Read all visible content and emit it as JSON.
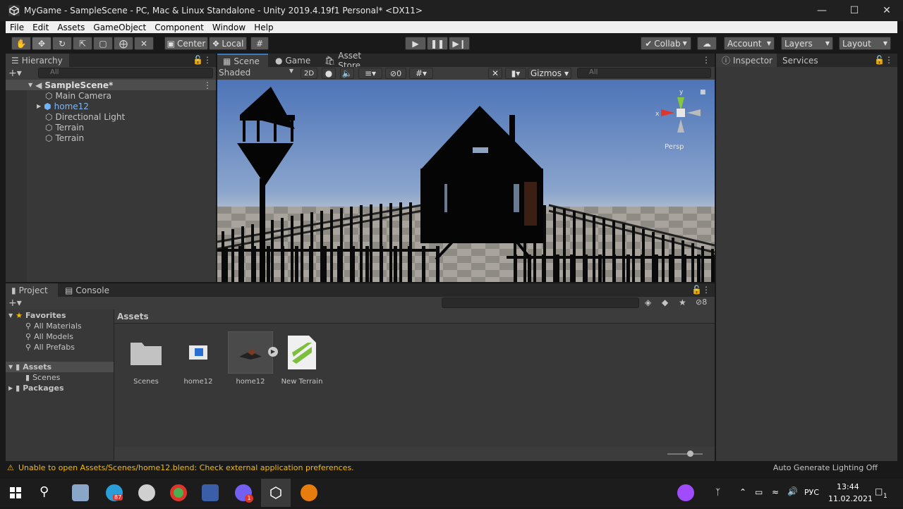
{
  "window": {
    "title": "MyGame - SampleScene - PC, Mac & Linux Standalone - Unity 2019.4.19f1 Personal* <DX11>"
  },
  "menu": [
    "File",
    "Edit",
    "Assets",
    "GameObject",
    "Component",
    "Window",
    "Help"
  ],
  "toolbar": {
    "center_label": "Center",
    "local_label": "Local",
    "collab_label": "Collab",
    "account_label": "Account",
    "layers_label": "Layers",
    "layout_label": "Layout"
  },
  "hierarchy": {
    "tab": "Hierarchy",
    "search_placeholder": "All",
    "scene": "SampleScene*",
    "items": [
      "Main Camera",
      "home12",
      "Directional Light",
      "Terrain",
      "Terrain"
    ]
  },
  "scene_tabs": {
    "scene": "Scene",
    "game": "Game",
    "asset_store": "Asset Store"
  },
  "scene_toolbar": {
    "shading": "Shaded",
    "mode2d": "2D",
    "hidden_count": "0",
    "gizmos": "Gizmos",
    "search_placeholder": "All"
  },
  "gizmo": {
    "x": "x",
    "y": "y",
    "persp": "Persp"
  },
  "inspector": {
    "tab": "Inspector",
    "services": "Services"
  },
  "project": {
    "tab": "Project",
    "console": "Console",
    "favorites": {
      "label": "Favorites",
      "items": [
        "All Materials",
        "All Models",
        "All Prefabs"
      ]
    },
    "tree": {
      "assets": "Assets",
      "scenes": "Scenes",
      "packages": "Packages"
    },
    "breadcrumb": "Assets",
    "hidden_count": "8",
    "assets": [
      "Scenes",
      "home12",
      "home12",
      "New Terrain"
    ]
  },
  "status": {
    "message": "Unable to open Assets/Scenes/home12.blend: Check external application preferences.",
    "lighting": "Auto Generate Lighting Off"
  },
  "taskbar": {
    "telegram_badge": "87",
    "viber_badge": "1",
    "lang": "РУС",
    "time": "13:44",
    "date": "11.02.2021",
    "notif": "1"
  },
  "colors": {
    "accent": "#3a79bb",
    "selected": "#2c5d87",
    "warning": "#f4bc02",
    "gizmo_x": "#e0352b",
    "gizmo_y": "#86c83d"
  }
}
